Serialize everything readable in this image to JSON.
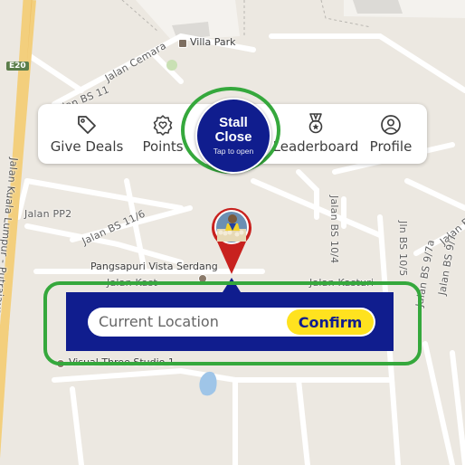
{
  "map": {
    "roads": {
      "e20_shield": "E20",
      "jalan_cemara": "Jalan Cemara",
      "jalan_bs_11": "Jalan BS 11",
      "jalan_pp2": "Jalan PP2",
      "jalan_bs_11_6": "Jalan BS 11/6",
      "jalan_bs_10_4": "Jalan BS 10/4",
      "jln_bs_10_5": "Jln BS 10/5",
      "jalan_bs_9_7": "Jalan BS 9/7",
      "jalan_bs_9_7a": "Jalan BS 9/7a",
      "jalan_kasturi_left": "Jalan Kast",
      "jalan_kasturi_right": "Jalan Kasturi",
      "highway": "Jalan Kuala Lumpur - Putrajaya"
    },
    "places": {
      "villa_park": "Villa Park",
      "pangsapuri": "Pangsapuri Vista Serdang",
      "visual_three": "Visual Three Studio 1"
    }
  },
  "menu": {
    "give_deals": "Give Deals",
    "points": "Points",
    "leaderboard": "Leaderboard",
    "profile": "Profile"
  },
  "stall": {
    "title": "Stall Close",
    "subtitle": "Tap to open"
  },
  "location": {
    "placeholder": "Current Location",
    "confirm": "Confirm"
  },
  "colors": {
    "brand_blue": "#101d8e",
    "accent_yellow": "#ffe21f",
    "highlight_green": "#35a83c",
    "map_bg": "#ece8e1",
    "pin_red": "#c8211e"
  }
}
